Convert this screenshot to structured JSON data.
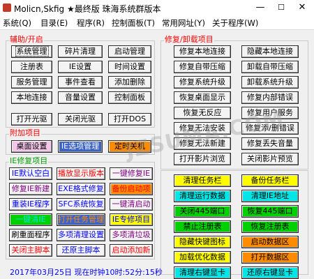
{
  "window": {
    "title": "Molicn,Skfig ★最终版 珠海系统群版本",
    "minimize": "—",
    "maximize": "☐",
    "close": "✕"
  },
  "menu": [
    "系统(Q)",
    "目录(E)",
    "程序(R)",
    "控制面板(T)",
    "常用网址(Y)",
    "关于程序(W)"
  ],
  "aux": {
    "title": "辅助/开启",
    "buttons": [
      "系统管理",
      "碎片清理",
      "启动管理",
      "注册表",
      "IE设置",
      "时间设置",
      "服务管理",
      "事件查看",
      "添加删除",
      "本地连接",
      "音量设置",
      "控制面板",
      "打开光驱",
      "关闭光驱",
      "打开DOS"
    ]
  },
  "extra": {
    "title": "附加项目",
    "buttons": [
      "桌面设置",
      "IE选项管理",
      "定时关机"
    ]
  },
  "ie": {
    "title": "IE修复项目",
    "buttons": [
      "IE默认空白",
      "播放显示版本",
      "一键修复IE",
      "修复IE新建",
      "EXE格式修复",
      "备份启动项",
      "重装IE程序",
      "SFC系统恢复",
      "一键清启动",
      "一键清IE",
      "打开任务管理",
      "IE专修项目",
      "刷重面程序",
      "多项清理设置",
      "多项清垃圾",
      "关闭主脚本",
      "还原主脚本",
      "启动添加新"
    ]
  },
  "fix": {
    "title": "修复/卸载项目",
    "buttons": [
      "修复本地连接",
      "隐藏本地连接",
      "修复自带压缩",
      "卸载自带压缩",
      "修复系统升级",
      "卸载系统升级",
      "恢复桌面显示",
      "修复内部错误",
      "恢复无反应",
      "修复用户服务",
      "修复无法安装",
      "修复添/删错误",
      "修复无法新建",
      "修复丢失音量",
      "打开影片浏览",
      "关闭影片预览"
    ]
  },
  "tools": {
    "buttons": [
      "清理任务栏",
      "备份任务栏",
      "清理运行数据",
      "清理IE地址",
      "关闭445端口",
      "恢复445端口",
      "禁止注册表",
      "恢复注册表",
      "隐藏快键图标",
      "启动数据区",
      "加载优化数据",
      "打开数据区",
      "清理右键显卡",
      "还原右键显卡"
    ]
  },
  "status": {
    "datetime": "2017年03月25日 现在时钟10时:52分:15秒"
  },
  "watermark": "JZSUMA.COM",
  "colors": {
    "red": "#ff0000",
    "blue": "#0000ff",
    "purple": "#800080",
    "orange": "#ff8c00",
    "green": "#00a000",
    "pink_bg": "#f4c6e9",
    "orange_bg": "#ff8c00",
    "blue_bg": "#3c64c8",
    "yellow_bg": "#fffc00",
    "green_bg": "#00d000",
    "cyan_bg": "#00e6e6"
  }
}
